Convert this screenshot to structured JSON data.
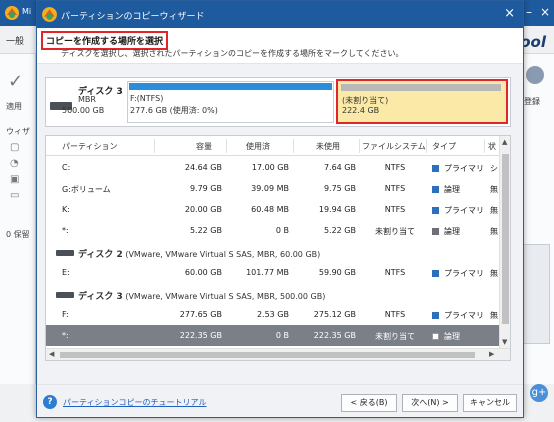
{
  "app": {
    "title_fragment": "Mi",
    "tab_label": "一般",
    "logo_text": "ool",
    "left_labels": [
      "適用",
      "ウィザ",
      "0 保留"
    ],
    "right_label": "登録",
    "minimize": "–",
    "close": "×"
  },
  "dialog": {
    "title": "パーティションのコピーウィザード",
    "close": "×",
    "header_title": "コピーを作成する場所を選択",
    "header_subtitle": "ディスクを選択し、選択されたパーティションのコピーを作成する場所をマークしてください。"
  },
  "diskmap": {
    "disk_name": "ディスク 3",
    "disk_type": "MBR",
    "disk_size": "500.00 GB",
    "part1_label": "F:(NTFS)",
    "part1_detail": "277.6 GB (使用済: 0%)",
    "part2_label": "(未割り当て)",
    "part2_detail": "222.4 GB"
  },
  "table": {
    "headers": [
      "パーティション",
      "容量",
      "使用済",
      "未使用",
      "ファイルシステム",
      "タイプ",
      "状"
    ],
    "rows": [
      {
        "kind": "part",
        "name": "C:",
        "cap": "24.64 GB",
        "used": "17.00 GB",
        "free": "7.64 GB",
        "fs": "NTFS",
        "type": "プライマリ",
        "type_icon": "blue",
        "status": "シ",
        "selected": false
      },
      {
        "kind": "part",
        "name": "G:ボリューム",
        "cap": "9.79 GB",
        "used": "39.09 MB",
        "free": "9.75 GB",
        "fs": "NTFS",
        "type": "論理",
        "type_icon": "blue",
        "status": "無",
        "selected": false
      },
      {
        "kind": "part",
        "name": "K:",
        "cap": "20.00 GB",
        "used": "60.48 MB",
        "free": "19.94 GB",
        "fs": "NTFS",
        "type": "プライマリ",
        "type_icon": "blue",
        "status": "無",
        "selected": false
      },
      {
        "kind": "part",
        "name": "*:",
        "cap": "5.22 GB",
        "used": "0 B",
        "free": "5.22 GB",
        "fs": "未割り当て",
        "type": "論理",
        "type_icon": "gray",
        "status": "無",
        "selected": false
      },
      {
        "kind": "disk",
        "name": "ディスク 2",
        "desc": "(VMware, VMware Virtual S SAS, MBR, 60.00 GB)"
      },
      {
        "kind": "part",
        "name": "E:",
        "cap": "60.00 GB",
        "used": "101.77 MB",
        "free": "59.90 GB",
        "fs": "NTFS",
        "type": "プライマリ",
        "type_icon": "blue",
        "status": "無",
        "selected": false
      },
      {
        "kind": "disk",
        "name": "ディスク 3",
        "desc": "(VMware, VMware Virtual S SAS, MBR, 500.00 GB)"
      },
      {
        "kind": "part",
        "name": "F:",
        "cap": "277.65 GB",
        "used": "2.53 GB",
        "free": "275.12 GB",
        "fs": "NTFS",
        "type": "プライマリ",
        "type_icon": "blue",
        "status": "無",
        "selected": false
      },
      {
        "kind": "part",
        "name": "*:",
        "cap": "222.35 GB",
        "used": "0 B",
        "free": "222.35 GB",
        "fs": "未割り当て",
        "type": "論理",
        "type_icon": "white",
        "status": "",
        "selected": true
      }
    ]
  },
  "footer": {
    "help_icon": "?",
    "help_link": "パーティションコピーのチュートリアル",
    "back": "< 戻る(B)",
    "next": "次へ(N) >",
    "cancel": "キャンセル"
  }
}
